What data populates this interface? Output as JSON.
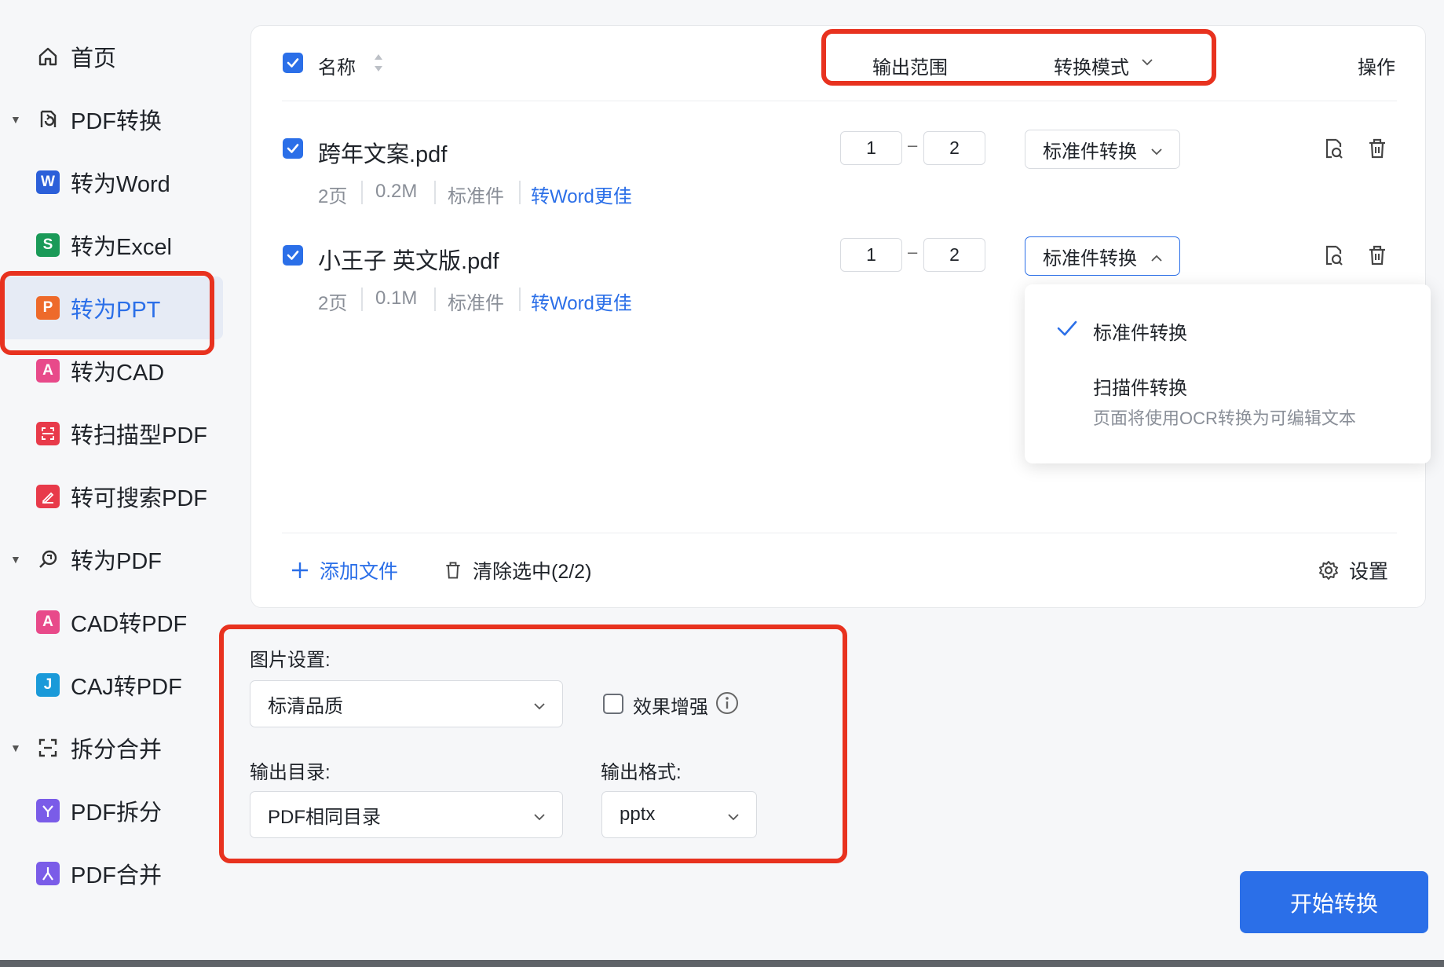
{
  "sidebar": {
    "items": [
      {
        "label": "首页",
        "icon": "home-icon"
      },
      {
        "label": "PDF转换",
        "icon": "pdf-convert-icon",
        "expanded": true
      },
      {
        "label": "转为Word",
        "icon": "word-icon",
        "badge": "W",
        "color": "#2b5fd9"
      },
      {
        "label": "转为Excel",
        "icon": "excel-icon",
        "badge": "S",
        "color": "#1a9a58"
      },
      {
        "label": "转为PPT",
        "icon": "ppt-icon",
        "badge": "P",
        "color": "#ee6a2a",
        "active": true
      },
      {
        "label": "转为CAD",
        "icon": "cad-icon",
        "badge": "A",
        "color": "#e84a8a"
      },
      {
        "label": "转扫描型PDF",
        "icon": "scan-pdf-icon",
        "color": "#e83a4a"
      },
      {
        "label": "转可搜索PDF",
        "icon": "searchable-pdf-icon",
        "color": "#e83a4a"
      },
      {
        "label": "转为PDF",
        "icon": "to-pdf-icon",
        "expanded": true
      },
      {
        "label": "CAD转PDF",
        "icon": "cad-pdf-icon",
        "badge": "A",
        "color": "#e84a8a"
      },
      {
        "label": "CAJ转PDF",
        "icon": "caj-pdf-icon",
        "badge": "J",
        "color": "#1a9ad9"
      },
      {
        "label": "拆分合并",
        "icon": "split-merge-icon",
        "expanded": true
      },
      {
        "label": "PDF拆分",
        "icon": "pdf-split-icon",
        "color": "#7a5ce8"
      },
      {
        "label": "PDF合并",
        "icon": "pdf-merge-icon",
        "color": "#7a5ce8"
      }
    ]
  },
  "table": {
    "col_name": "名称",
    "col_range": "输出范围",
    "col_mode": "转换模式",
    "col_action": "操作"
  },
  "files": [
    {
      "name": "跨年文案.pdf",
      "pages": "2页",
      "size": "0.2M",
      "type": "标准件",
      "tip": "转Word更佳",
      "from": "1",
      "to": "2",
      "mode": "标准件转换"
    },
    {
      "name": "小王子 英文版.pdf",
      "pages": "2页",
      "size": "0.1M",
      "type": "标准件",
      "tip": "转Word更佳",
      "from": "1",
      "to": "2",
      "mode": "标准件转换"
    }
  ],
  "dropdown": {
    "option1": "标准件转换",
    "option2": "扫描件转换",
    "option2_desc": "页面将使用OCR转换为可编辑文本"
  },
  "footer": {
    "add_file": "添加文件",
    "clear_selected": "清除选中(2/2)",
    "settings": "设置"
  },
  "settings": {
    "image_label": "图片设置:",
    "image_value": "标清品质",
    "enhance_label": "效果增强",
    "output_dir_label": "输出目录:",
    "output_dir_value": "PDF相同目录",
    "output_format_label": "输出格式:",
    "output_format_value": "pptx"
  },
  "start_button": "开始转换",
  "colors": {
    "accent": "#2b6fe8",
    "highlight": "#e8321f"
  }
}
